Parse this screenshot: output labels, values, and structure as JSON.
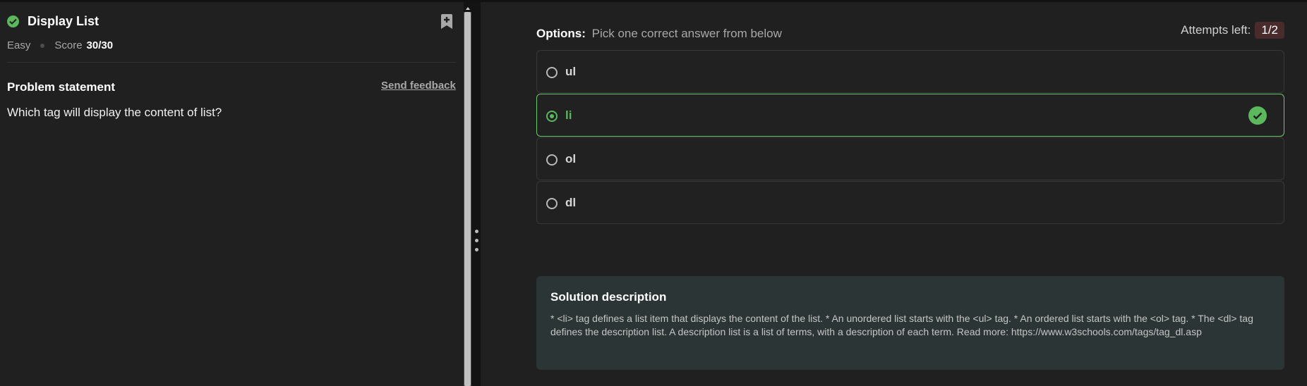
{
  "problem": {
    "title": "Display List",
    "difficulty": "Easy",
    "score_label": "Score",
    "score_value": "30/30",
    "statement_heading": "Problem statement",
    "feedback_link": "Send feedback",
    "statement": "Which tag will display the content of list?"
  },
  "options_header": {
    "label": "Options:",
    "hint": "Pick one correct answer from below"
  },
  "attempts": {
    "label": "Attempts left:",
    "value": "1/2"
  },
  "options": [
    {
      "label": "ul",
      "selected": false,
      "correct": false
    },
    {
      "label": "li",
      "selected": true,
      "correct": true
    },
    {
      "label": "ol",
      "selected": false,
      "correct": false
    },
    {
      "label": "dl",
      "selected": false,
      "correct": false
    }
  ],
  "solution": {
    "title": "Solution description",
    "body": "* <li> tag defines a list item that displays the content of the list. * An unordered list starts with the <ul> tag. * An ordered list starts with the <ol> tag. * The <dl> tag defines the description list. A description list is a list of terms, with a description of each term. Read more: https://www.w3schools.com/tags/tag_dl.asp"
  },
  "icons": {
    "solved": "check-circle-icon",
    "bookmark": "bookmark-add-icon",
    "correct": "check-circle-icon",
    "resize": "vertical-dots-icon"
  },
  "colors": {
    "accent_green": "#5cb85c",
    "attempts_badge": "#4a2b2b",
    "solution_bg": "#2c3535",
    "panel_bg": "#202020"
  }
}
